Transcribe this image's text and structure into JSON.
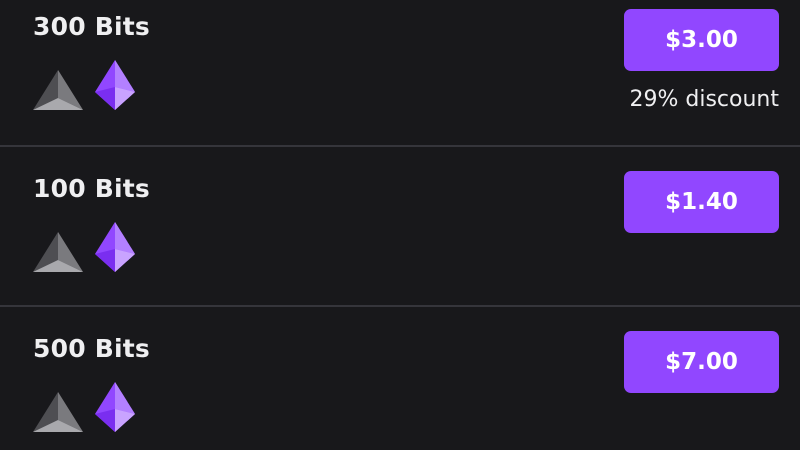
{
  "bits_offers": [
    {
      "amount_label": "300 Bits",
      "price_label": "$3.00",
      "discount_label": "29% discount"
    },
    {
      "amount_label": "100 Bits",
      "price_label": "$1.40"
    },
    {
      "amount_label": "500 Bits",
      "price_label": "$7.00"
    }
  ],
  "colors": {
    "background": "#18181b",
    "accent": "#9147ff",
    "divider": "#35353b",
    "text": "#efeff1"
  },
  "icons": [
    "gray-bit-gem-icon",
    "purple-bit-gem-icon"
  ]
}
